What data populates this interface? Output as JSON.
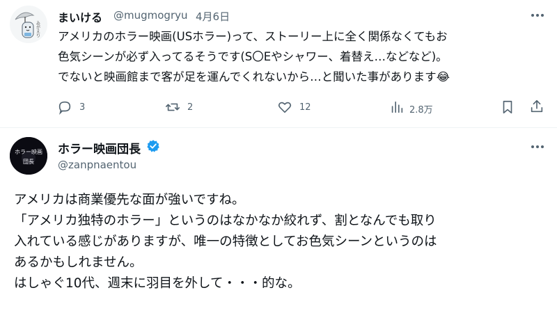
{
  "post1": {
    "display_name": "まいける",
    "handle": "@mugmogryu",
    "separator": "·",
    "date": "4月6日",
    "lines": [
      "アメリカのホラー映画(USホラー)って、ストーリー上に全く関係なくてもお",
      "色気シーンが必ず入ってるそうです(S〇Eやシャワー、着替え…などなど)。",
      "でないと映画館まで客が足を運んでくれないから…と聞いた事があります"
    ],
    "emoji": "😂",
    "avatar_caption": "ゐがえり",
    "metrics": {
      "replies": "3",
      "reposts": "2",
      "likes": "12",
      "views": "2.8万"
    },
    "icons": [
      "more-icon",
      "reply-icon",
      "repost-icon",
      "like-icon",
      "views-icon",
      "bookmark-icon",
      "share-icon"
    ]
  },
  "post2": {
    "display_name": "ホラー映画団長",
    "handle": "@zanpnaentou",
    "avatar_text_top": "ホラー映画",
    "avatar_text_bottom": "団長",
    "verified_color": "#1d9bf0",
    "lines": [
      "アメリカは商業優先な面が強いですね。",
      "「アメリカ独特のホラー」というのはなかなか絞れず、割となんでも取り",
      "入れている感じがありますが、唯一の特徴としてお色気シーンというのは",
      "あるかもしれません。",
      "はしゃぐ10代、週末に羽目を外して・・・的な。"
    ]
  },
  "colors": {
    "text": "#0f1419",
    "secondary": "#536471",
    "verified": "#1d9bf0",
    "divider": "#eff3f4"
  }
}
